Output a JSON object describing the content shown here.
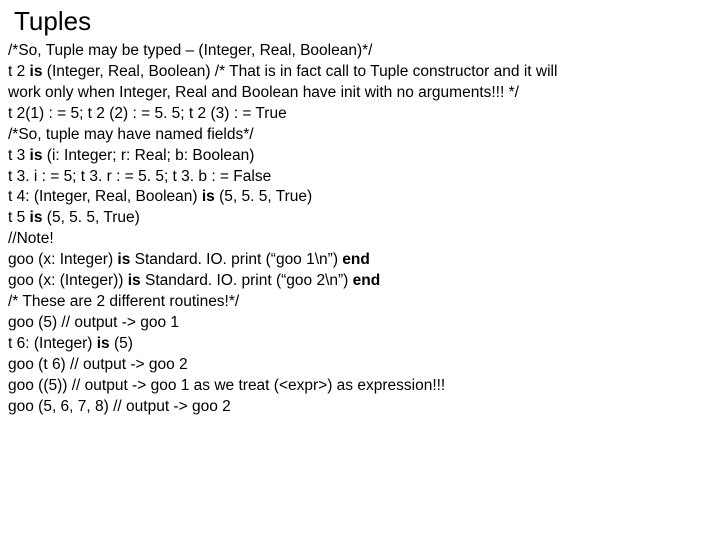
{
  "title": "Tuples",
  "lines": [
    [
      {
        "t": "/*So, Tuple may be typed – (Integer, Real, Boolean)*/"
      }
    ],
    [
      {
        "t": "t 2 "
      },
      {
        "t": "is",
        "b": true
      },
      {
        "t": " (Integer, Real, Boolean) /* That is in fact call to Tuple constructor and it will"
      }
    ],
    [
      {
        "t": "work only when Integer, Real and Boolean have init with no arguments!!! */"
      }
    ],
    [
      {
        "t": "t 2(1) : = 5; t 2 (2) : = 5. 5; t 2 (3) : = True"
      }
    ],
    [
      {
        "t": "/*So, tuple may have named fields*/"
      }
    ],
    [
      {
        "t": "t 3 "
      },
      {
        "t": "is",
        "b": true
      },
      {
        "t": " (i: Integer; r: Real; b: Boolean)"
      }
    ],
    [
      {
        "t": "t 3. i : = 5; t 3. r : = 5. 5; t 3. b : = False"
      }
    ],
    [
      {
        "t": "t 4: (Integer, Real, Boolean) "
      },
      {
        "t": "is",
        "b": true
      },
      {
        "t": " (5, 5. 5, True)"
      }
    ],
    [
      {
        "t": "t 5 "
      },
      {
        "t": "is",
        "b": true
      },
      {
        "t": " (5, 5. 5, True)"
      }
    ],
    [
      {
        "t": "//Note!"
      }
    ],
    [
      {
        "t": "goo (x: Integer) "
      },
      {
        "t": "is",
        "b": true
      },
      {
        "t": " Standard. IO. print (“goo 1\\n”) "
      },
      {
        "t": "end",
        "b": true
      }
    ],
    [
      {
        "t": "goo (x: (Integer)) "
      },
      {
        "t": "is",
        "b": true
      },
      {
        "t": " Standard. IO. print (“goo 2\\n”)  "
      },
      {
        "t": "end",
        "b": true
      }
    ],
    [
      {
        "t": "/* These are 2 different routines!*/"
      }
    ],
    [
      {
        "t": "goo (5) // output -> goo 1"
      }
    ],
    [
      {
        "t": "t 6: (Integer) "
      },
      {
        "t": "is",
        "b": true
      },
      {
        "t": " (5)"
      }
    ],
    [
      {
        "t": "goo (t 6) // output -> goo 2"
      }
    ],
    [
      {
        "t": "goo ((5)) // output -> goo 1 as we treat (<expr>) as expression!!!"
      }
    ],
    [
      {
        "t": "goo (5, 6, 7, 8) // output -> goo 2"
      }
    ]
  ]
}
